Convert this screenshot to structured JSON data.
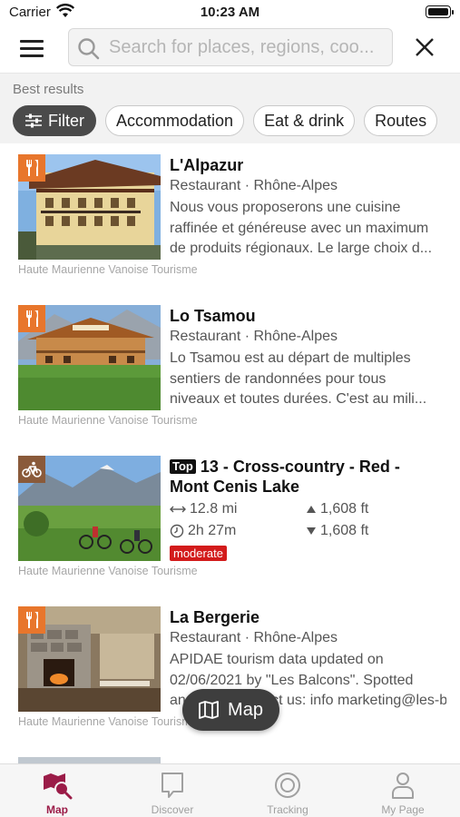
{
  "status_bar": {
    "carrier": "Carrier",
    "time": "10:23 AM"
  },
  "search": {
    "placeholder": "Search for places, regions, coo...",
    "value": ""
  },
  "filters": {
    "section_label": "Best results",
    "chips": [
      "Filter",
      "Accommodation",
      "Eat & drink",
      "Routes"
    ]
  },
  "results": [
    {
      "title": "L'Alpazur",
      "subtitle": "Restaurant · Rhône-Alpes",
      "description": [
        "Nous vous proposerons une cuisine",
        "raffinée et généreuse avec un maximum",
        "de produits régionaux. Le large choix d..."
      ],
      "credit": "Haute Maurienne Vanoise Tourisme",
      "category_icon": "fork-knife-icon"
    },
    {
      "title": "Lo Tsamou",
      "subtitle": "Restaurant · Rhône-Alpes",
      "description": [
        "Lo Tsamou est au départ de multiples",
        "sentiers de randonnées pour tous",
        "niveaux et toutes durées. C'est au mili..."
      ],
      "credit": "Haute Maurienne Vanoise Tourisme",
      "category_icon": "fork-knife-icon"
    },
    {
      "tag": "Top",
      "title_line1": "13 - Cross-country - Red -",
      "title_line2": "Mont Cenis Lake",
      "distance": "12.8 mi",
      "duration": "2h 27m",
      "ascent": "1,608 ft",
      "descent": "1,608 ft",
      "difficulty": "moderate",
      "credit": "Haute Maurienne Vanoise Tourisme",
      "category_icon": "bicycle-icon"
    },
    {
      "title": "La Bergerie",
      "subtitle": "Restaurant · Rhône-Alpes",
      "description": [
        "APIDAE tourism data updated on",
        "02/06/2021 by \"Les Balcons\". Spotted",
        "an error? Contact us: info marketing@les-balc..."
      ],
      "credit": "Haute Maurienne Vanoise Tourisme",
      "category_icon": "fork-knife-icon"
    }
  ],
  "map_button": {
    "label": "Map"
  },
  "tabbar": {
    "tabs": [
      {
        "label": "Map",
        "active": true
      },
      {
        "label": "Discover",
        "active": false
      },
      {
        "label": "Tracking",
        "active": false
      },
      {
        "label": "My Page",
        "active": false
      }
    ]
  },
  "colors": {
    "accent": "#9b1c48",
    "restaurant_badge": "#e8762c",
    "bike_badge": "#8a5a3a",
    "difficulty": "#d31b1b"
  }
}
